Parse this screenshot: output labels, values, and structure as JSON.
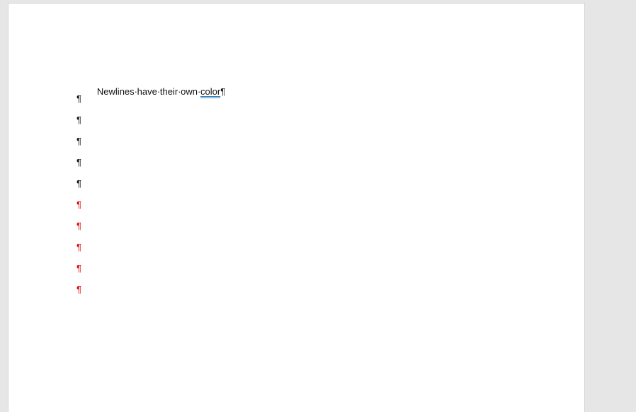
{
  "document": {
    "first_line": {
      "words": [
        "Newlines",
        "have",
        "their",
        "own",
        "color"
      ],
      "space_mark": "·",
      "flagged_word_index": 4,
      "end_mark": "¶"
    },
    "empty_paragraphs": [
      {
        "mark": "¶",
        "color": "#111111"
      },
      {
        "mark": "¶",
        "color": "#111111"
      },
      {
        "mark": "¶",
        "color": "#111111"
      },
      {
        "mark": "¶",
        "color": "#111111"
      },
      {
        "mark": "¶",
        "color": "#111111"
      },
      {
        "mark": "¶",
        "color": "#e00000"
      },
      {
        "mark": "¶",
        "color": "#e00000"
      },
      {
        "mark": "¶",
        "color": "#e00000"
      },
      {
        "mark": "¶",
        "color": "#e00000"
      },
      {
        "mark": "¶",
        "color": "#e00000"
      }
    ]
  },
  "colors": {
    "workspace_background": "#e6e6e6",
    "page_background": "#ffffff",
    "default_mark": "#111111",
    "red_mark": "#e00000",
    "spellcheck_underline": "#2b7bb9"
  }
}
